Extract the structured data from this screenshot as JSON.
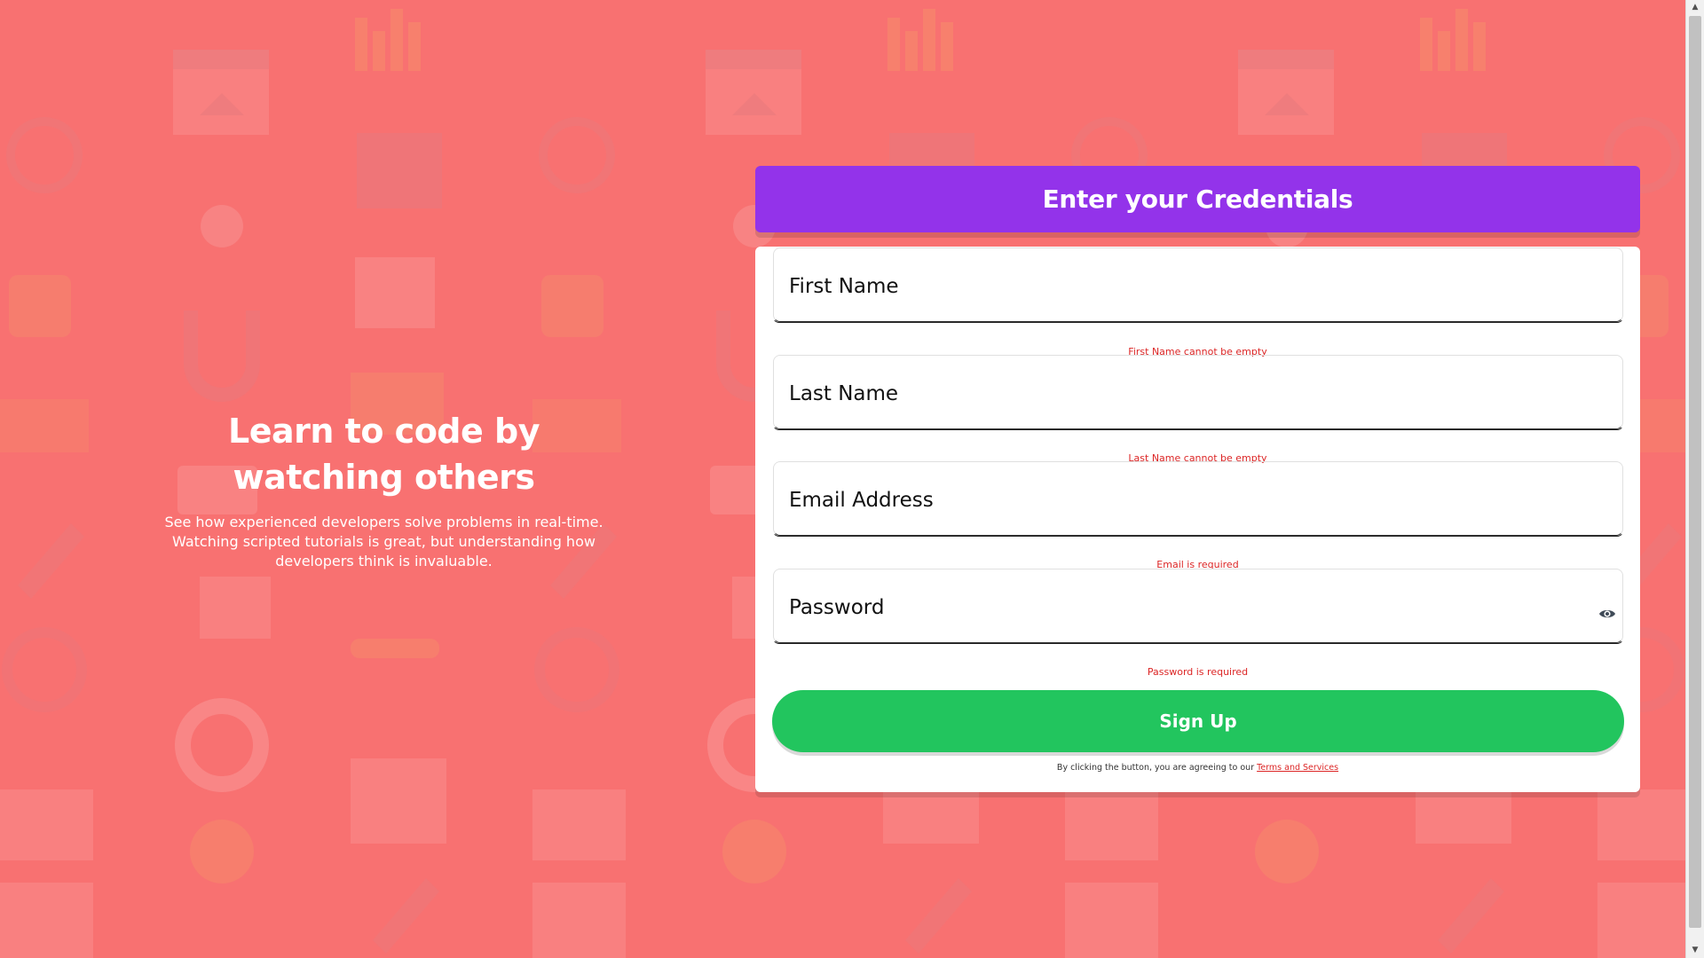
{
  "hero": {
    "title_line1": "Learn to code by",
    "title_line2": "watching others",
    "description_line1": "See how experienced developers solve problems in real-time.",
    "description_line2": "Watching scripted tutorials is great, but understanding how",
    "description_line3": "developers think is invaluable."
  },
  "header": {
    "title": "Enter your Credentials"
  },
  "form": {
    "first_name": {
      "placeholder": "First Name",
      "value": "",
      "error": "First Name cannot be empty"
    },
    "last_name": {
      "placeholder": "Last Name",
      "value": "",
      "error": "Last Name cannot be empty"
    },
    "email": {
      "placeholder": "Email Address",
      "value": "",
      "error": "Email is required"
    },
    "password": {
      "placeholder": "Password",
      "value": "",
      "error": "Password is required",
      "toggle_icon": "eye-icon"
    },
    "submit_label": "Sign Up",
    "terms_prefix": "By clicking the button, you are agreeing to our ",
    "terms_link": "Terms and Services"
  },
  "colors": {
    "background": "#f87171",
    "header": "#9333ea",
    "button": "#22c55e",
    "error": "#dc2626"
  }
}
